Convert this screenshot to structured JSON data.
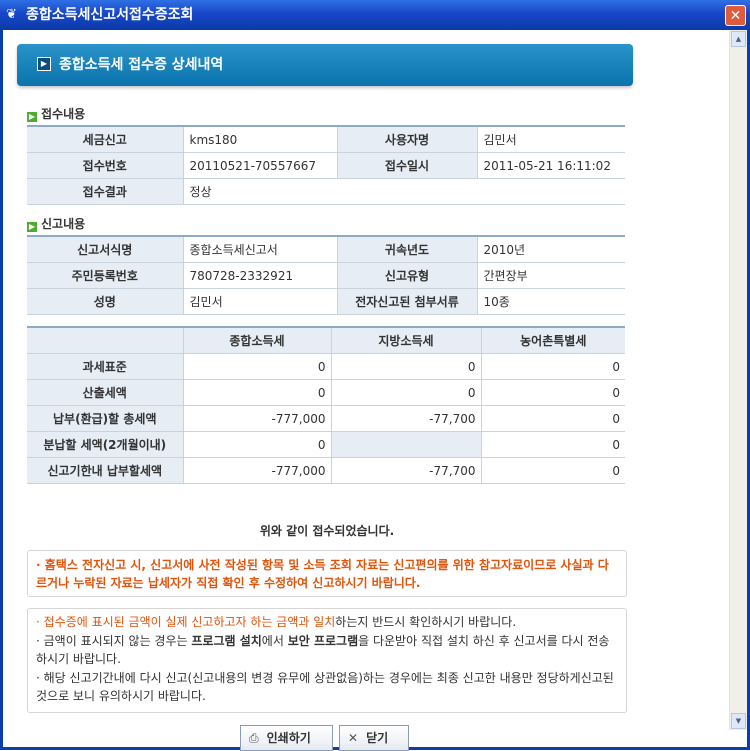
{
  "window": {
    "title": "종합소득세신고서접수증조회",
    "close": "✕"
  },
  "banner": {
    "title": "종합소득세 접수증 상세내역"
  },
  "receipt": {
    "title": "접수내용",
    "rows": [
      [
        {
          "label": "세금신고",
          "value": "kms180"
        },
        {
          "label": "사용자명",
          "value": "김민서"
        }
      ],
      [
        {
          "label": "접수번호",
          "value": "20110521-70557667"
        },
        {
          "label": "접수일시",
          "value": "2011-05-21 16:11:02"
        }
      ]
    ],
    "result_label": "접수결과",
    "result_value": "정상"
  },
  "report": {
    "title": "신고내용",
    "rows": [
      [
        {
          "label": "신고서식명",
          "value": "종합소득세신고서"
        },
        {
          "label": "귀속년도",
          "value": "2010년"
        }
      ],
      [
        {
          "label": "주민등록번호",
          "value": "780728-2332921"
        },
        {
          "label": "신고유형",
          "value": "간편장부"
        }
      ],
      [
        {
          "label": "성명",
          "value": "김민서"
        },
        {
          "label": "전자신고된 첨부서류",
          "value": "10종"
        }
      ]
    ]
  },
  "tax_table": {
    "headers": [
      "종합소득세",
      "지방소득세",
      "농어촌특별세"
    ],
    "rows": [
      {
        "label": "과세표준",
        "values": [
          "0",
          "0",
          "0"
        ]
      },
      {
        "label": "산출세액",
        "values": [
          "0",
          "0",
          "0"
        ]
      },
      {
        "label": "납부(환급)할 총세액",
        "values": [
          "-777,000",
          "-77,700",
          "0"
        ]
      },
      {
        "label": "분납할 세액(2개월이내)",
        "values": [
          "0",
          "",
          "0"
        ]
      },
      {
        "label": "신고기한내 납부할세액",
        "values": [
          "-777,000",
          "-77,700",
          "0"
        ]
      }
    ]
  },
  "message": "위와 같이 접수되었습니다.",
  "notice_main": "· 홈택스 전자신고 시, 신고서에 사전 작성된 항목 및 소득 조회 자료는 신고편의를 위한 참고자료이므로 사실과 다르거나 누락된 자료는 납세자가 직접 확인 후 수정하여 신고하시기 바랍니다.",
  "notices": {
    "n1_orange": "· 접수증에 표시된 금액이 실제 신고하고자 하는 금액과 일치",
    "n1_rest": "하는지 반드시 확인하시기 바랍니다.",
    "n2_a": "· 금액이 표시되지 않는 경우는 ",
    "n2_b": "프로그램 설치",
    "n2_c": "에서 ",
    "n2_d": "보안 프로그램",
    "n2_e": "을 다운받아 직접 설치 하신 후 신고서를 다시 전송하시기 바랍니다.",
    "n3": "· 해당 신고기간내에 다시 신고(신고내용의 변경 유무에 상관없음)하는 경우에는 최종 신고한 내용만 정당하게신고된 것으로 보니 유의하시기 바랍니다."
  },
  "buttons": {
    "print": "인쇄하기",
    "close": "닫기"
  }
}
